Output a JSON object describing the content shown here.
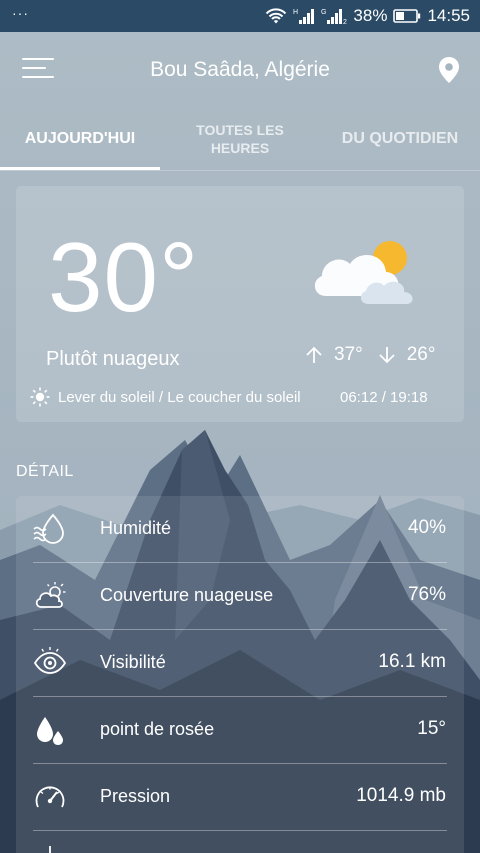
{
  "status_bar": {
    "notification_dots": "···",
    "network_1": "H",
    "network_2": "G",
    "battery_percent": "38%",
    "time": "14:55"
  },
  "app_bar": {
    "location": "Bou Saâda, Algérie",
    "menu_icon": "hamburger-menu-icon",
    "location_icon": "map-pin-icon"
  },
  "tabs": [
    {
      "label": "AUJOURD'HUI",
      "active": true
    },
    {
      "label": "TOUTES LES HEURES",
      "line1": "TOUTES LES",
      "line2": "HEURES",
      "active": false
    },
    {
      "label": "DU QUOTIDIEN",
      "active": false
    }
  ],
  "current": {
    "temperature": "30°",
    "condition": "Plutôt nuageux",
    "high": "37°",
    "low": "26°",
    "sun_label": "Lever du soleil / Le coucher du soleil",
    "sun_times": "06:12 / 19:18",
    "weather_icon": "partly-cloudy-icon"
  },
  "detail": {
    "heading": "DÉTAIL",
    "rows": [
      {
        "icon": "humidity-icon",
        "label": "Humidité",
        "value": "40%"
      },
      {
        "icon": "cloud-cover-icon",
        "label": "Couverture nuageuse",
        "value": "76%"
      },
      {
        "icon": "visibility-eye-icon",
        "label": "Visibilité",
        "value": "16.1 km"
      },
      {
        "icon": "dew-point-icon",
        "label": "point de rosée",
        "value": "15°"
      },
      {
        "icon": "pressure-gauge-icon",
        "label": "Pression",
        "value": "1014.9 mb"
      }
    ]
  },
  "colors": {
    "status_bar": "#2a4a66",
    "sky": "#a6b6c0",
    "sun": "#f5b82e",
    "mountain_dark": "#2c3b4f"
  }
}
